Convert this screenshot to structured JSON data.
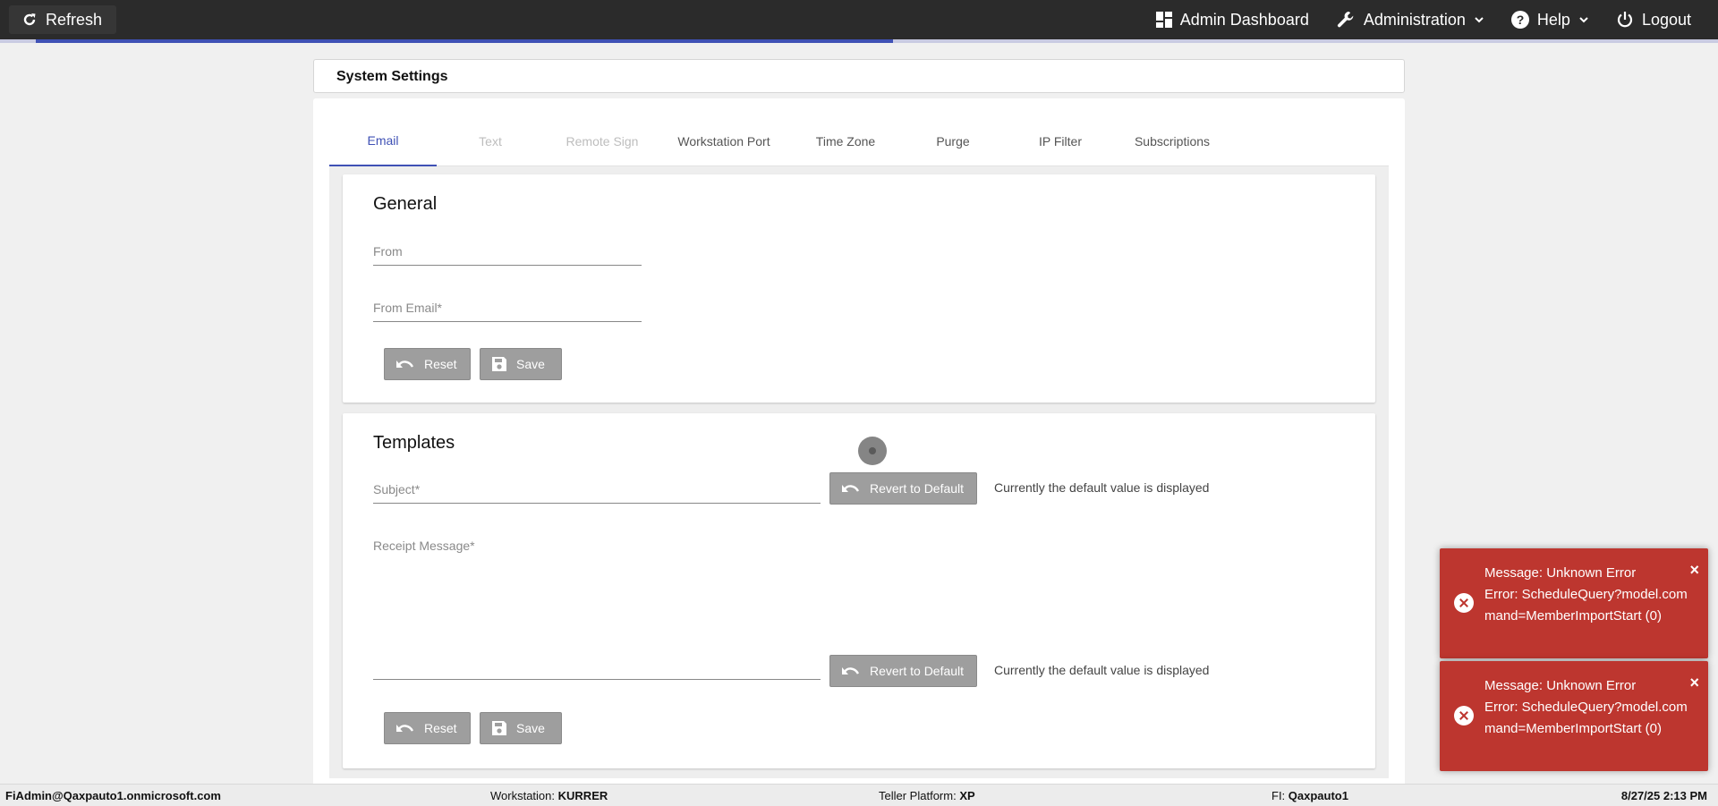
{
  "topbar": {
    "refresh_label": "Refresh",
    "nav": {
      "admin_dashboard": "Admin Dashboard",
      "administration": "Administration",
      "help": "Help",
      "logout": "Logout"
    }
  },
  "loading": {
    "progress_percent": 50
  },
  "page": {
    "title": "System Settings"
  },
  "tabs": [
    {
      "label": "Email",
      "state": "active"
    },
    {
      "label": "Text",
      "state": "disabled"
    },
    {
      "label": "Remote Sign",
      "state": "disabled"
    },
    {
      "label": "Workstation Port",
      "state": "normal"
    },
    {
      "label": "Time Zone",
      "state": "normal"
    },
    {
      "label": "Purge",
      "state": "normal"
    },
    {
      "label": "IP Filter",
      "state": "normal"
    },
    {
      "label": "Subscriptions",
      "state": "normal"
    }
  ],
  "general": {
    "title": "General",
    "from_label": "From",
    "from_value": "",
    "from_email_label": "From Email*",
    "from_email_value": "",
    "reset_label": "Reset",
    "save_label": "Save"
  },
  "templates": {
    "title": "Templates",
    "subject_label": "Subject*",
    "subject_value": "",
    "receipt_label": "Receipt Message*",
    "receipt_value": "",
    "revert_label": "Revert to Default",
    "default_note": "Currently the default value is displayed",
    "reset_label": "Reset",
    "save_label": "Save"
  },
  "toasts": [
    {
      "line1": "Message: Unknown Error",
      "line2": "Error: ScheduleQuery?model.command=MemberImportStart (0)"
    },
    {
      "line1": "Message: Unknown Error",
      "line2": "Error: ScheduleQuery?model.command=MemberImportStart (0)"
    }
  ],
  "status": {
    "user": "FiAdmin@Qaxpauto1.onmicrosoft.com",
    "workstation_label": "Workstation:",
    "workstation": "KURRER",
    "platform_label": "Teller Platform:",
    "platform": "XP",
    "fi_label": "FI:",
    "fi": "Qaxpauto1",
    "datetime": "8/27/25 2:13 PM"
  },
  "colors": {
    "topbar": "#2b2b2b",
    "accent": "#3f51b5",
    "button_gray": "#9e9e9e",
    "toast_error": "#bd362f"
  },
  "icons": [
    "refresh-icon",
    "dashboard-icon",
    "wrench-icon",
    "help-icon",
    "power-icon",
    "chevron-down-icon",
    "undo-icon",
    "floppy-icon",
    "error-icon",
    "close-icon"
  ]
}
